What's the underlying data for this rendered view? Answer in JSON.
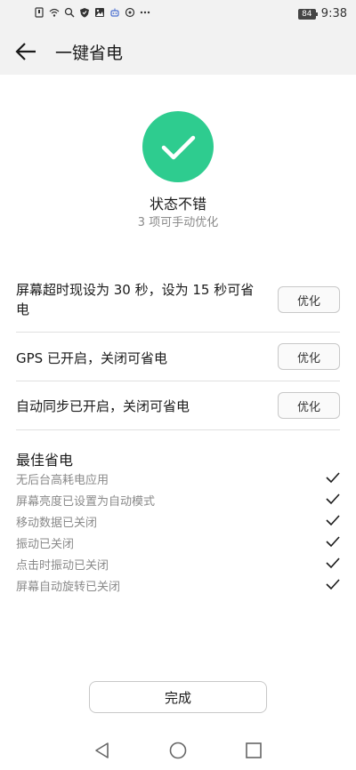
{
  "statusbar": {
    "battery": "84",
    "time": "9:38",
    "left_icons": [
      "sim-icon",
      "wifi-icon",
      "search-icon",
      "shield-icon",
      "photo-icon",
      "robot-icon",
      "settings-icon",
      "more-icon"
    ]
  },
  "header": {
    "title": "一键省电"
  },
  "status": {
    "title": "状态不错",
    "subtitle": "3 项可手动优化",
    "color": "#2ecc8f"
  },
  "optimizations": [
    {
      "text": "屏幕超时现设为 30 秒，设为 15 秒可省电",
      "button": "优化"
    },
    {
      "text": "GPS 已开启，关闭可省电",
      "button": "优化"
    },
    {
      "text": "自动同步已开启，关闭可省电",
      "button": "优化"
    }
  ],
  "best": {
    "title": "最佳省电",
    "items": [
      "无后台高耗电应用",
      "屏幕亮度已设置为自动模式",
      "移动数据已关闭",
      "振动已关闭",
      "点击时振动已关闭",
      "屏幕自动旋转已关闭"
    ]
  },
  "footer": {
    "done_label": "完成"
  },
  "navbar": {
    "icons": [
      "back-triangle-icon",
      "home-circle-icon",
      "recents-square-icon"
    ]
  }
}
